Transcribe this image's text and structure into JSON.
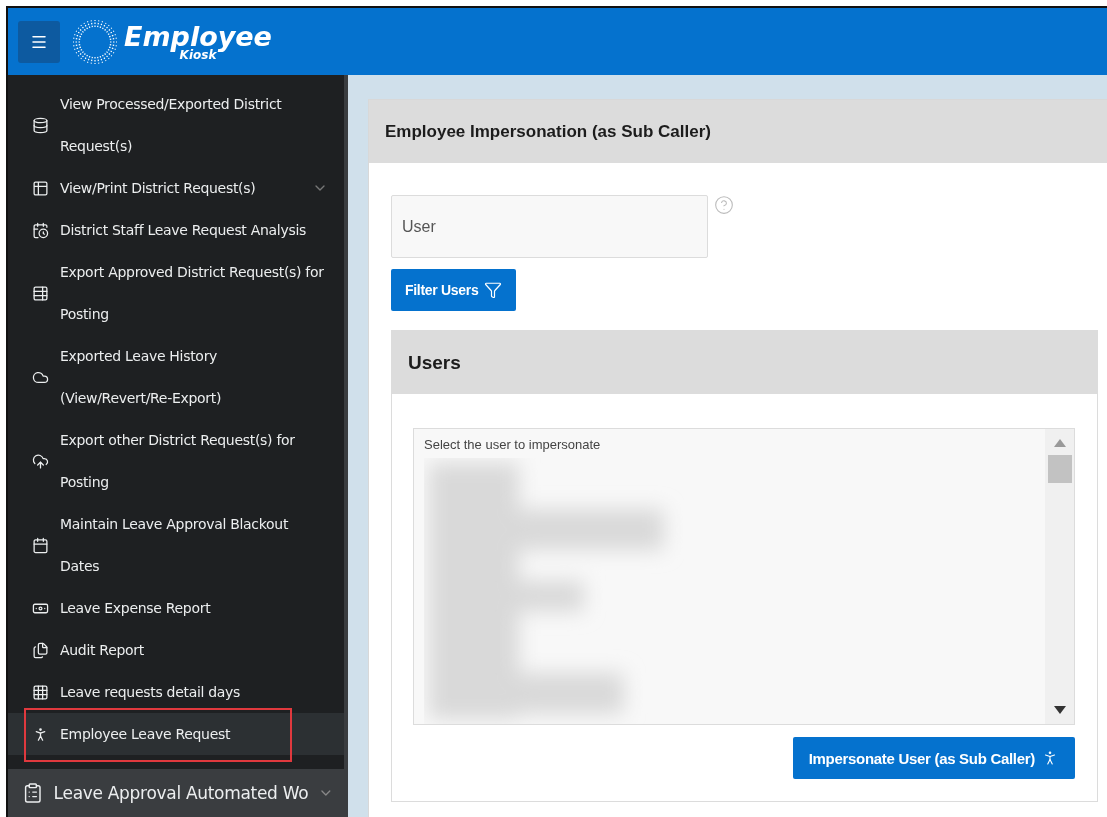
{
  "header": {
    "logo": {
      "title": "Employee",
      "subtitle": "Kiosk"
    }
  },
  "sidebar": {
    "items": [
      {
        "kind": "database",
        "label": "View Processed/Exported District\nRequest(s)",
        "selected": false,
        "highlighted": false
      },
      {
        "kind": "table-search",
        "label": "View/Print District Request(s)",
        "selected": false,
        "highlighted": false,
        "expanded": false
      },
      {
        "kind": "calendar-clock",
        "label": "District Staff Leave Request Analysis",
        "selected": false,
        "highlighted": false
      },
      {
        "kind": "table-up",
        "label": "Export Approved District Request(s) for\nPosting",
        "selected": false,
        "highlighted": false
      },
      {
        "kind": "cloud-search",
        "label": "Exported Leave History\n(View/Revert/Re-Export)",
        "selected": false,
        "highlighted": false
      },
      {
        "kind": "cloud-up",
        "label": "Export other District Request(s) for\nPosting",
        "selected": false,
        "highlighted": false
      },
      {
        "kind": "calendar",
        "label": "Maintain Leave Approval Blackout\nDates",
        "selected": false,
        "highlighted": false
      },
      {
        "kind": "money",
        "label": "Leave Expense Report",
        "selected": false,
        "highlighted": false
      },
      {
        "kind": "files",
        "label": "Audit Report",
        "selected": false,
        "highlighted": false
      },
      {
        "kind": "grid",
        "label": "Leave requests detail days",
        "selected": false,
        "highlighted": false
      },
      {
        "kind": "person",
        "label": "Employee Leave Request",
        "selected": true,
        "highlighted": true
      }
    ],
    "group": {
      "label": "Leave Approval Automated Wo",
      "expanded": false
    }
  },
  "main": {
    "title": "Employee Impersonation (as Sub Caller)",
    "user_field": {
      "placeholder": "User"
    },
    "filter_button": "Filter Users",
    "users": {
      "title": "Users",
      "list_label": "Select the user to impersonate",
      "button": "Impersonate User (as Sub Caller)"
    }
  }
}
